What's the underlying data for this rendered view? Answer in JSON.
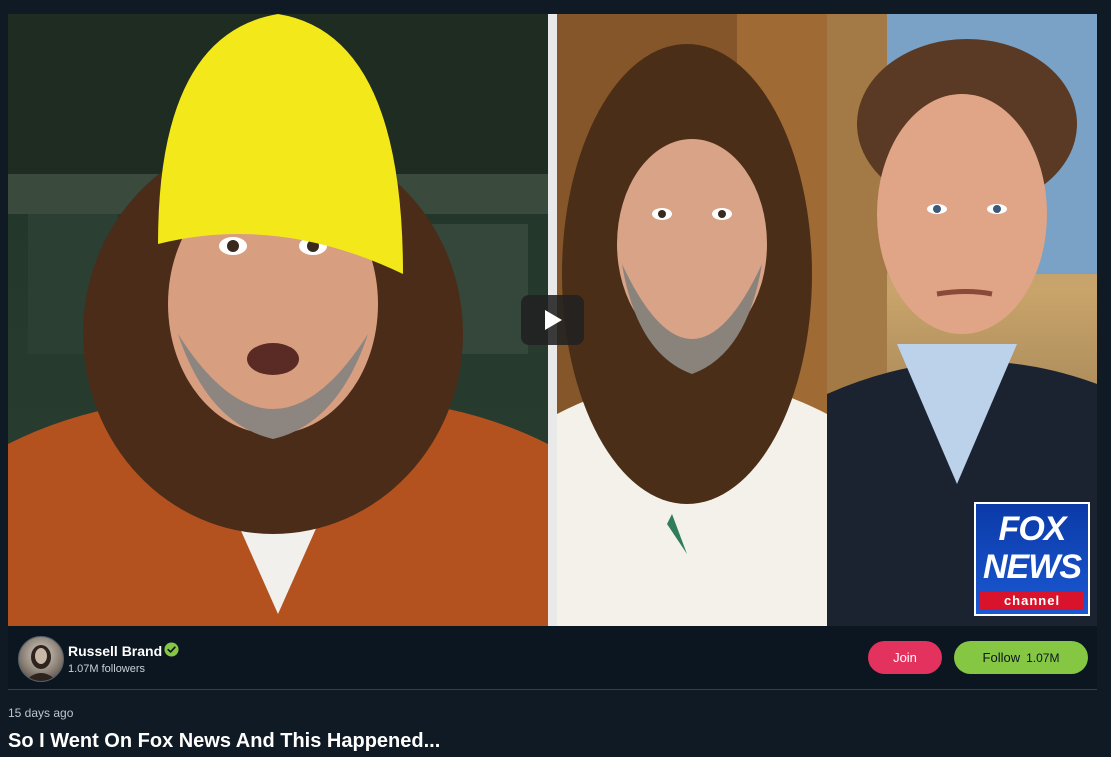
{
  "video": {
    "play_icon": "play-icon",
    "thumbnail_badge": {
      "line1": "FOX",
      "line2": "NEWS",
      "line3": "channel"
    }
  },
  "channel": {
    "name": "Russell Brand",
    "verified_icon": "verified-check-icon",
    "followers": "1.07M followers",
    "join_label": "Join",
    "follow_label": "Follow",
    "follow_count": "1.07M"
  },
  "meta": {
    "upload_date": "15 days ago",
    "title": "So I Went On Fox News And This Happened..."
  },
  "colors": {
    "background": "#0f1a24",
    "join": "#e4325e",
    "follow": "#85c742",
    "verified": "#85c742"
  }
}
